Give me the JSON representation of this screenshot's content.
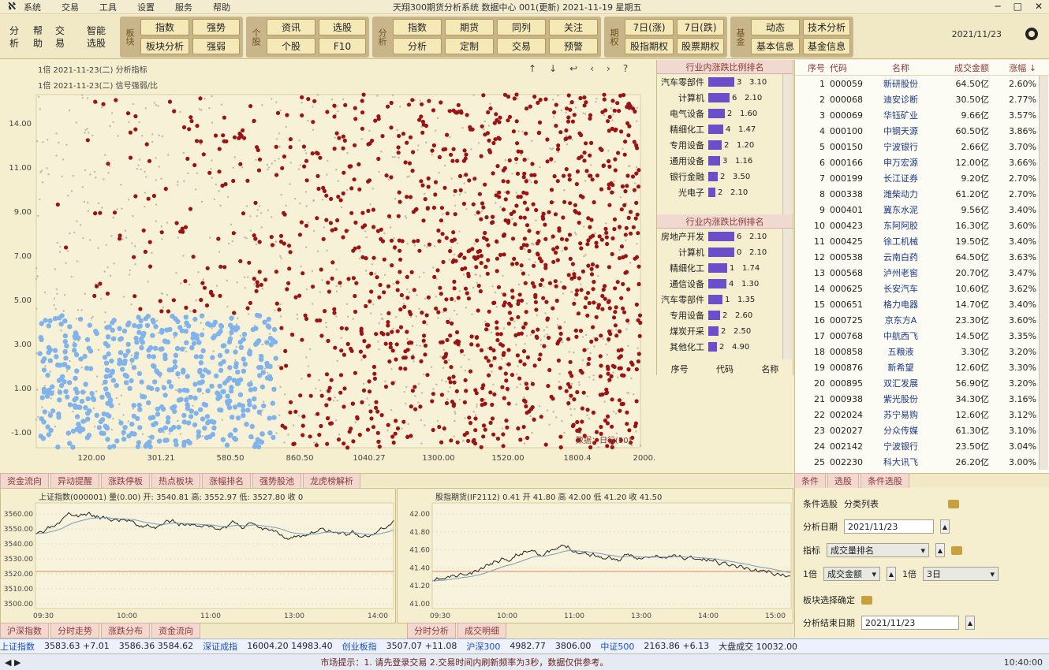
{
  "menu": {
    "logo": "ℵ",
    "items": [
      "系统",
      "交易",
      "工具",
      "设置",
      "服务",
      "帮助"
    ],
    "title": "天翔300期货分析系统  数据中心  001(更新)  2021-11-19  星期五",
    "controls": [
      "─",
      "□",
      "✕"
    ]
  },
  "toolbar": {
    "quick": [
      {
        "l1": "分",
        "l2": "析"
      },
      {
        "l1": "帮",
        "l2": "助"
      },
      {
        "l1": "交",
        "l2": "易"
      },
      {
        "l1": "智能",
        "l2": "选股"
      }
    ],
    "groups": [
      {
        "label": "板块",
        "buttons": [
          "指数",
          "强势",
          "板块分析",
          "强弱"
        ]
      },
      {
        "label": "个股",
        "buttons": [
          "资讯",
          "选股",
          "个股",
          "F10"
        ]
      },
      {
        "label": "分析",
        "buttons": [
          "指数",
          "期货",
          "同列",
          "关注",
          "分析",
          "定制",
          "交易",
          "预警"
        ]
      },
      {
        "label": "期权",
        "buttons": [
          "7日(涨)",
          "7日(跌)",
          "股指期权",
          "股票期权"
        ]
      },
      {
        "label": "基金",
        "buttons": [
          "动态",
          "技术分析",
          "基本信息",
          "基金信息"
        ]
      }
    ],
    "date": "2021/11/23"
  },
  "scatter": {
    "legend1": "1倍   2021-11-23(二)   分析指标",
    "legend2": "1倍   2021-11-23(二)   信号强弱/比",
    "tools": [
      "↑",
      "↓",
      "↩",
      "‹",
      "›",
      "?"
    ],
    "x_ticks": [
      "120.00",
      "301.21",
      "580.50",
      "860.50",
      "1040.27",
      "1300.00",
      "1520.00",
      "1800.4",
      "2000.0"
    ],
    "y_ticks": [
      "14.00",
      "11.00",
      "9.00",
      "7.00",
      "5.00",
      "3.00",
      "1.00",
      "-1.00"
    ],
    "footer": "数据：日行(50)"
  },
  "industry": {
    "header1": "行业内涨跌比例排名",
    "top": [
      {
        "name": "汽车零部件",
        "count": "3",
        "pct": "3.10",
        "frac": 0.55
      },
      {
        "name": "计算机",
        "count": "6",
        "pct": "2.10",
        "frac": 0.45
      },
      {
        "name": "电气设备",
        "count": "2",
        "pct": "1.60",
        "frac": 0.35
      },
      {
        "name": "精细化工",
        "count": "4",
        "pct": "1.47",
        "frac": 0.32
      },
      {
        "name": "专用设备",
        "count": "2",
        "pct": "1.20",
        "frac": 0.28
      },
      {
        "name": "通用设备",
        "count": "3",
        "pct": "1.16",
        "frac": 0.25
      },
      {
        "name": "银行金融",
        "count": "2",
        "pct": "3.50",
        "frac": 0.2
      },
      {
        "name": "光电子",
        "count": "2",
        "pct": "2.10",
        "frac": 0.15
      }
    ],
    "header2": "行业内涨跌比例排名",
    "bottom": [
      {
        "name": "房地产开发",
        "count": "6",
        "pct": "2.10",
        "frac": 0.55
      },
      {
        "name": "计算机",
        "count": "0",
        "pct": "2.10",
        "frac": 0.55
      },
      {
        "name": "精细化工",
        "count": "1",
        "pct": "1.74",
        "frac": 0.4
      },
      {
        "name": "通信设备",
        "count": "4",
        "pct": "1.30",
        "frac": 0.38
      },
      {
        "name": "汽车零部件",
        "count": "1",
        "pct": "1.35",
        "frac": 0.3
      },
      {
        "name": "专用设备",
        "count": "2",
        "pct": "2.60",
        "frac": 0.25
      },
      {
        "name": "煤炭开采",
        "count": "2",
        "pct": "2.50",
        "frac": 0.22
      },
      {
        "name": "其他化工",
        "count": "2",
        "pct": "4.90",
        "frac": 0.18
      }
    ],
    "foot_headers": [
      "序号",
      "代码",
      "名称"
    ]
  },
  "stocks": {
    "headers": [
      "序号",
      "代码",
      "名称",
      "成交金额",
      "涨幅 ↓"
    ],
    "rows": [
      [
        "1",
        "000059",
        "新研股份",
        "64.50亿",
        "2.60%"
      ],
      [
        "2",
        "000068",
        "迪安诊断",
        "30.50亿",
        "2.77%"
      ],
      [
        "3",
        "000069",
        "华钰矿业",
        "9.66亿",
        "3.57%"
      ],
      [
        "4",
        "000100",
        "中钢天源",
        "60.50亿",
        "3.86%"
      ],
      [
        "5",
        "000150",
        "宁波银行",
        "2.66亿",
        "3.70%"
      ],
      [
        "6",
        "000166",
        "申万宏源",
        "12.00亿",
        "3.66%"
      ],
      [
        "7",
        "000199",
        "长江证券",
        "9.20亿",
        "2.70%"
      ],
      [
        "8",
        "000338",
        "潍柴动力",
        "61.20亿",
        "2.70%"
      ],
      [
        "9",
        "000401",
        "冀东水泥",
        "9.56亿",
        "3.40%"
      ],
      [
        "10",
        "000423",
        "东阿阿胶",
        "16.30亿",
        "3.60%"
      ],
      [
        "11",
        "000425",
        "徐工机械",
        "19.50亿",
        "3.40%"
      ],
      [
        "12",
        "000538",
        "云南白药",
        "64.50亿",
        "3.63%"
      ],
      [
        "13",
        "000568",
        "泸州老窖",
        "20.70亿",
        "3.47%"
      ],
      [
        "14",
        "000625",
        "长安汽车",
        "10.60亿",
        "3.62%"
      ],
      [
        "15",
        "000651",
        "格力电器",
        "14.70亿",
        "3.40%"
      ],
      [
        "16",
        "000725",
        "京东方A",
        "23.30亿",
        "3.60%"
      ],
      [
        "17",
        "000768",
        "中航西飞",
        "14.50亿",
        "3.35%"
      ],
      [
        "18",
        "000858",
        "五粮液",
        "3.30亿",
        "3.20%"
      ],
      [
        "19",
        "000876",
        "新希望",
        "12.60亿",
        "3.30%"
      ],
      [
        "20",
        "000895",
        "双汇发展",
        "56.90亿",
        "3.20%"
      ],
      [
        "21",
        "000938",
        "紫光股份",
        "34.30亿",
        "3.16%"
      ],
      [
        "22",
        "002024",
        "苏宁易购",
        "12.60亿",
        "3.12%"
      ],
      [
        "23",
        "002027",
        "分众传媒",
        "61.30亿",
        "3.10%"
      ],
      [
        "24",
        "002142",
        "宁波银行",
        "23.50亿",
        "3.04%"
      ],
      [
        "25",
        "002230",
        "科大讯飞",
        "26.20亿",
        "3.00%"
      ]
    ]
  },
  "tabs": [
    "资金流向",
    "异动提醒",
    "涨跌停板",
    "热点板块",
    "涨幅排名",
    "强势股池",
    "龙虎榜解析"
  ],
  "right_tabs": [
    "条件",
    "选股",
    "条件选股"
  ],
  "mini1": {
    "title": "上证指数(000001)  量(0.00)  开: 3540.81  高: 3552.97  低: 3527.80  收 0",
    "y": [
      "3560.00",
      "3550.00",
      "3540.00",
      "3530.00",
      "3520.00",
      "3510.00",
      "3500.00"
    ],
    "x": [
      "09:30",
      "10:00",
      "11:00",
      "13:00",
      "14:00"
    ]
  },
  "mini2": {
    "title": "股指期货(IF2112)  0.41  开 41.80  高 42.00  低 41.20  收 41.50",
    "y": [
      "42.00",
      "41.80",
      "41.60",
      "41.40",
      "41.20",
      "41.00"
    ],
    "x": [
      "09:30",
      "10:00",
      "11:00",
      "13:00",
      "14:00",
      "15:00"
    ]
  },
  "mini_tabs": [
    "沪深指数",
    "分时走势",
    "涨跌分布",
    "资金流向"
  ],
  "mini_tabs2": [
    "分时分析",
    "成交明细"
  ],
  "query": {
    "rows": [
      {
        "label": "条件选股",
        "value": "分类列表"
      },
      {
        "label": "分析日期",
        "value": "2021/11/23"
      },
      {
        "label": "指标",
        "value": "成交量排名"
      },
      {
        "label": "1倍",
        "value": "成交金额",
        "label2": "1倍",
        "value2": "3日"
      },
      {
        "label": "板块选择确定",
        "value": ""
      },
      {
        "label": "分析结束日期",
        "value": "2021/11/23"
      }
    ]
  },
  "ticker": [
    {
      "t": "上证指数",
      "hl": true
    },
    {
      "t": "3583.63  +7.01"
    },
    {
      "t": "3586.36  3584.62"
    },
    {
      "t": "深证成指",
      "hl": true
    },
    {
      "t": "16004.20  14983.40"
    },
    {
      "t": "创业板指",
      "hl": true
    },
    {
      "t": "3507.07  +11.08"
    },
    {
      "t": "沪深300",
      "hl": true
    },
    {
      "t": "4982.77"
    },
    {
      "t": "3806.00"
    },
    {
      "t": "中证500",
      "hl": true
    },
    {
      "t": "2163.86  +6.13"
    },
    {
      "t": "大盘成交  10032.00"
    }
  ],
  "status": {
    "msg": "市场提示：1. 请先登录交易  2.交易时间内刷新频率为3秒，数据仅供参考。",
    "clock": "10:40:00"
  }
}
